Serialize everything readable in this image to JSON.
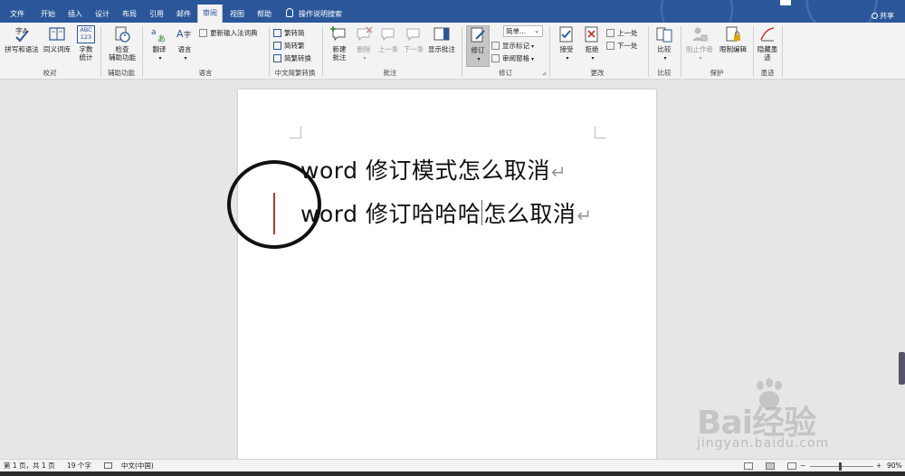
{
  "tabs": [
    {
      "label": "文件",
      "active": false
    },
    {
      "label": "开始",
      "active": false
    },
    {
      "label": "插入",
      "active": false
    },
    {
      "label": "设计",
      "active": false
    },
    {
      "label": "布局",
      "active": false
    },
    {
      "label": "引用",
      "active": false
    },
    {
      "label": "邮件",
      "active": false
    },
    {
      "label": "审阅",
      "active": true
    },
    {
      "label": "视图",
      "active": false
    },
    {
      "label": "帮助",
      "active": false
    }
  ],
  "tell_me": "操作说明搜索",
  "share": "共享",
  "ribbon": {
    "proofing": {
      "label": "校对",
      "spelling": "拼写和语法",
      "thesaurus": "同义词库",
      "wordcount_line1": "字数",
      "wordcount_line2": "统计",
      "wordcount_icon_text": "ABC\n123"
    },
    "accessibility": {
      "label": "辅助功能",
      "check_line1": "检查",
      "check_line2": "辅助功能"
    },
    "language": {
      "label": "语言",
      "translate": "翻译",
      "language": "语言",
      "update_ime": "更新输入法词典"
    },
    "chinese": {
      "label": "中文简繁转换",
      "to_simplified": "繁转简",
      "to_traditional": "简转繁",
      "convert": "简繁转换"
    },
    "comments": {
      "label": "批注",
      "new_line1": "新建",
      "new_line2": "批注",
      "delete": "删除",
      "prev": "上一条",
      "next": "下一条",
      "show": "显示批注"
    },
    "tracking": {
      "label": "修订",
      "track": "修订",
      "display_combo": "简单...",
      "show_markup": "显示标记",
      "review_pane": "审阅窗格"
    },
    "changes": {
      "label": "更改",
      "accept": "接受",
      "reject": "拒绝",
      "previous": "上一处",
      "next": "下一处"
    },
    "compare": {
      "label": "比较",
      "compare": "比较"
    },
    "protect": {
      "label": "保护",
      "block_authors": "阻止作者",
      "restrict": "限制编辑"
    },
    "ink": {
      "label": "墨迹",
      "hide_line1": "隐藏墨",
      "hide_line2": "迹"
    }
  },
  "document": {
    "line1": "word 修订模式怎么取消",
    "line2_before_cursor": "word 修订哈哈哈",
    "line2_after_cursor": "怎么取消",
    "paragraph_mark": "↵"
  },
  "status": {
    "page": "第 1 页，共 1 页",
    "words": "19 个字",
    "lang": "中文(中国)",
    "zoom": "90%"
  },
  "watermark": {
    "text": "Bai经验",
    "url": "jingyan.baidu.com"
  },
  "colors": {
    "ribbon_blue": "#2b579a",
    "change_bar": "#b83c2a"
  }
}
